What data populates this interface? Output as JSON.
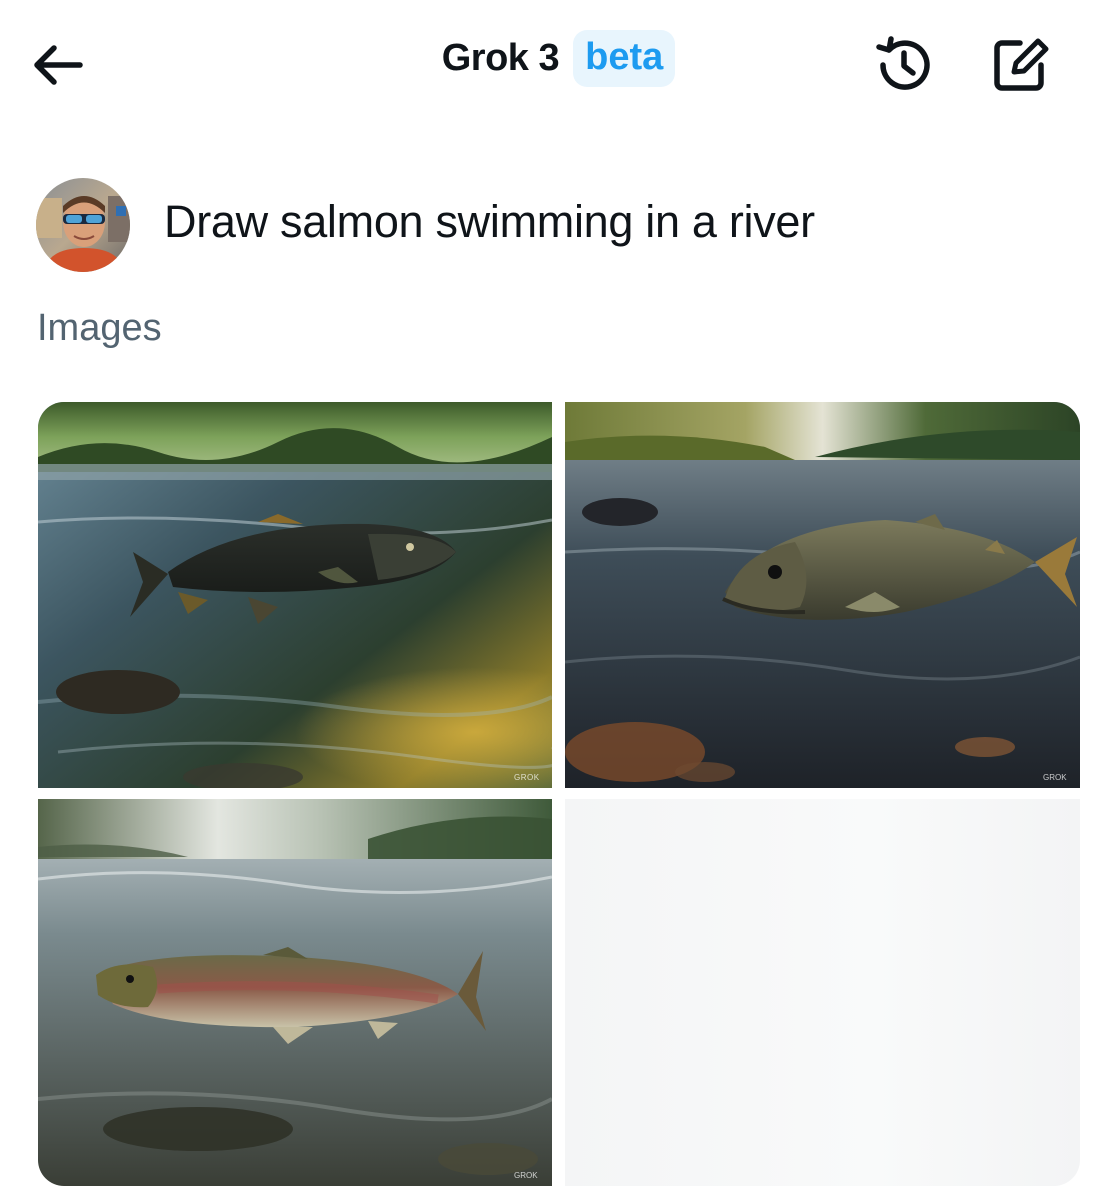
{
  "header": {
    "title": "Grok 3",
    "badge": "beta",
    "back_icon": "arrow-left-icon",
    "history_icon": "history-icon",
    "compose_icon": "compose-icon"
  },
  "prompt": {
    "avatar_icon": "user-avatar",
    "text": "Draw salmon swimming in a river"
  },
  "section": {
    "label": "Images"
  },
  "images": [
    {
      "watermark": "GROK"
    },
    {
      "watermark": "GROK"
    },
    {
      "watermark": "GROK"
    }
  ],
  "colors": {
    "accent": "#1d9bf0",
    "badge_bg": "#e8f5fd",
    "text": "#0f1419",
    "muted": "#536471"
  }
}
